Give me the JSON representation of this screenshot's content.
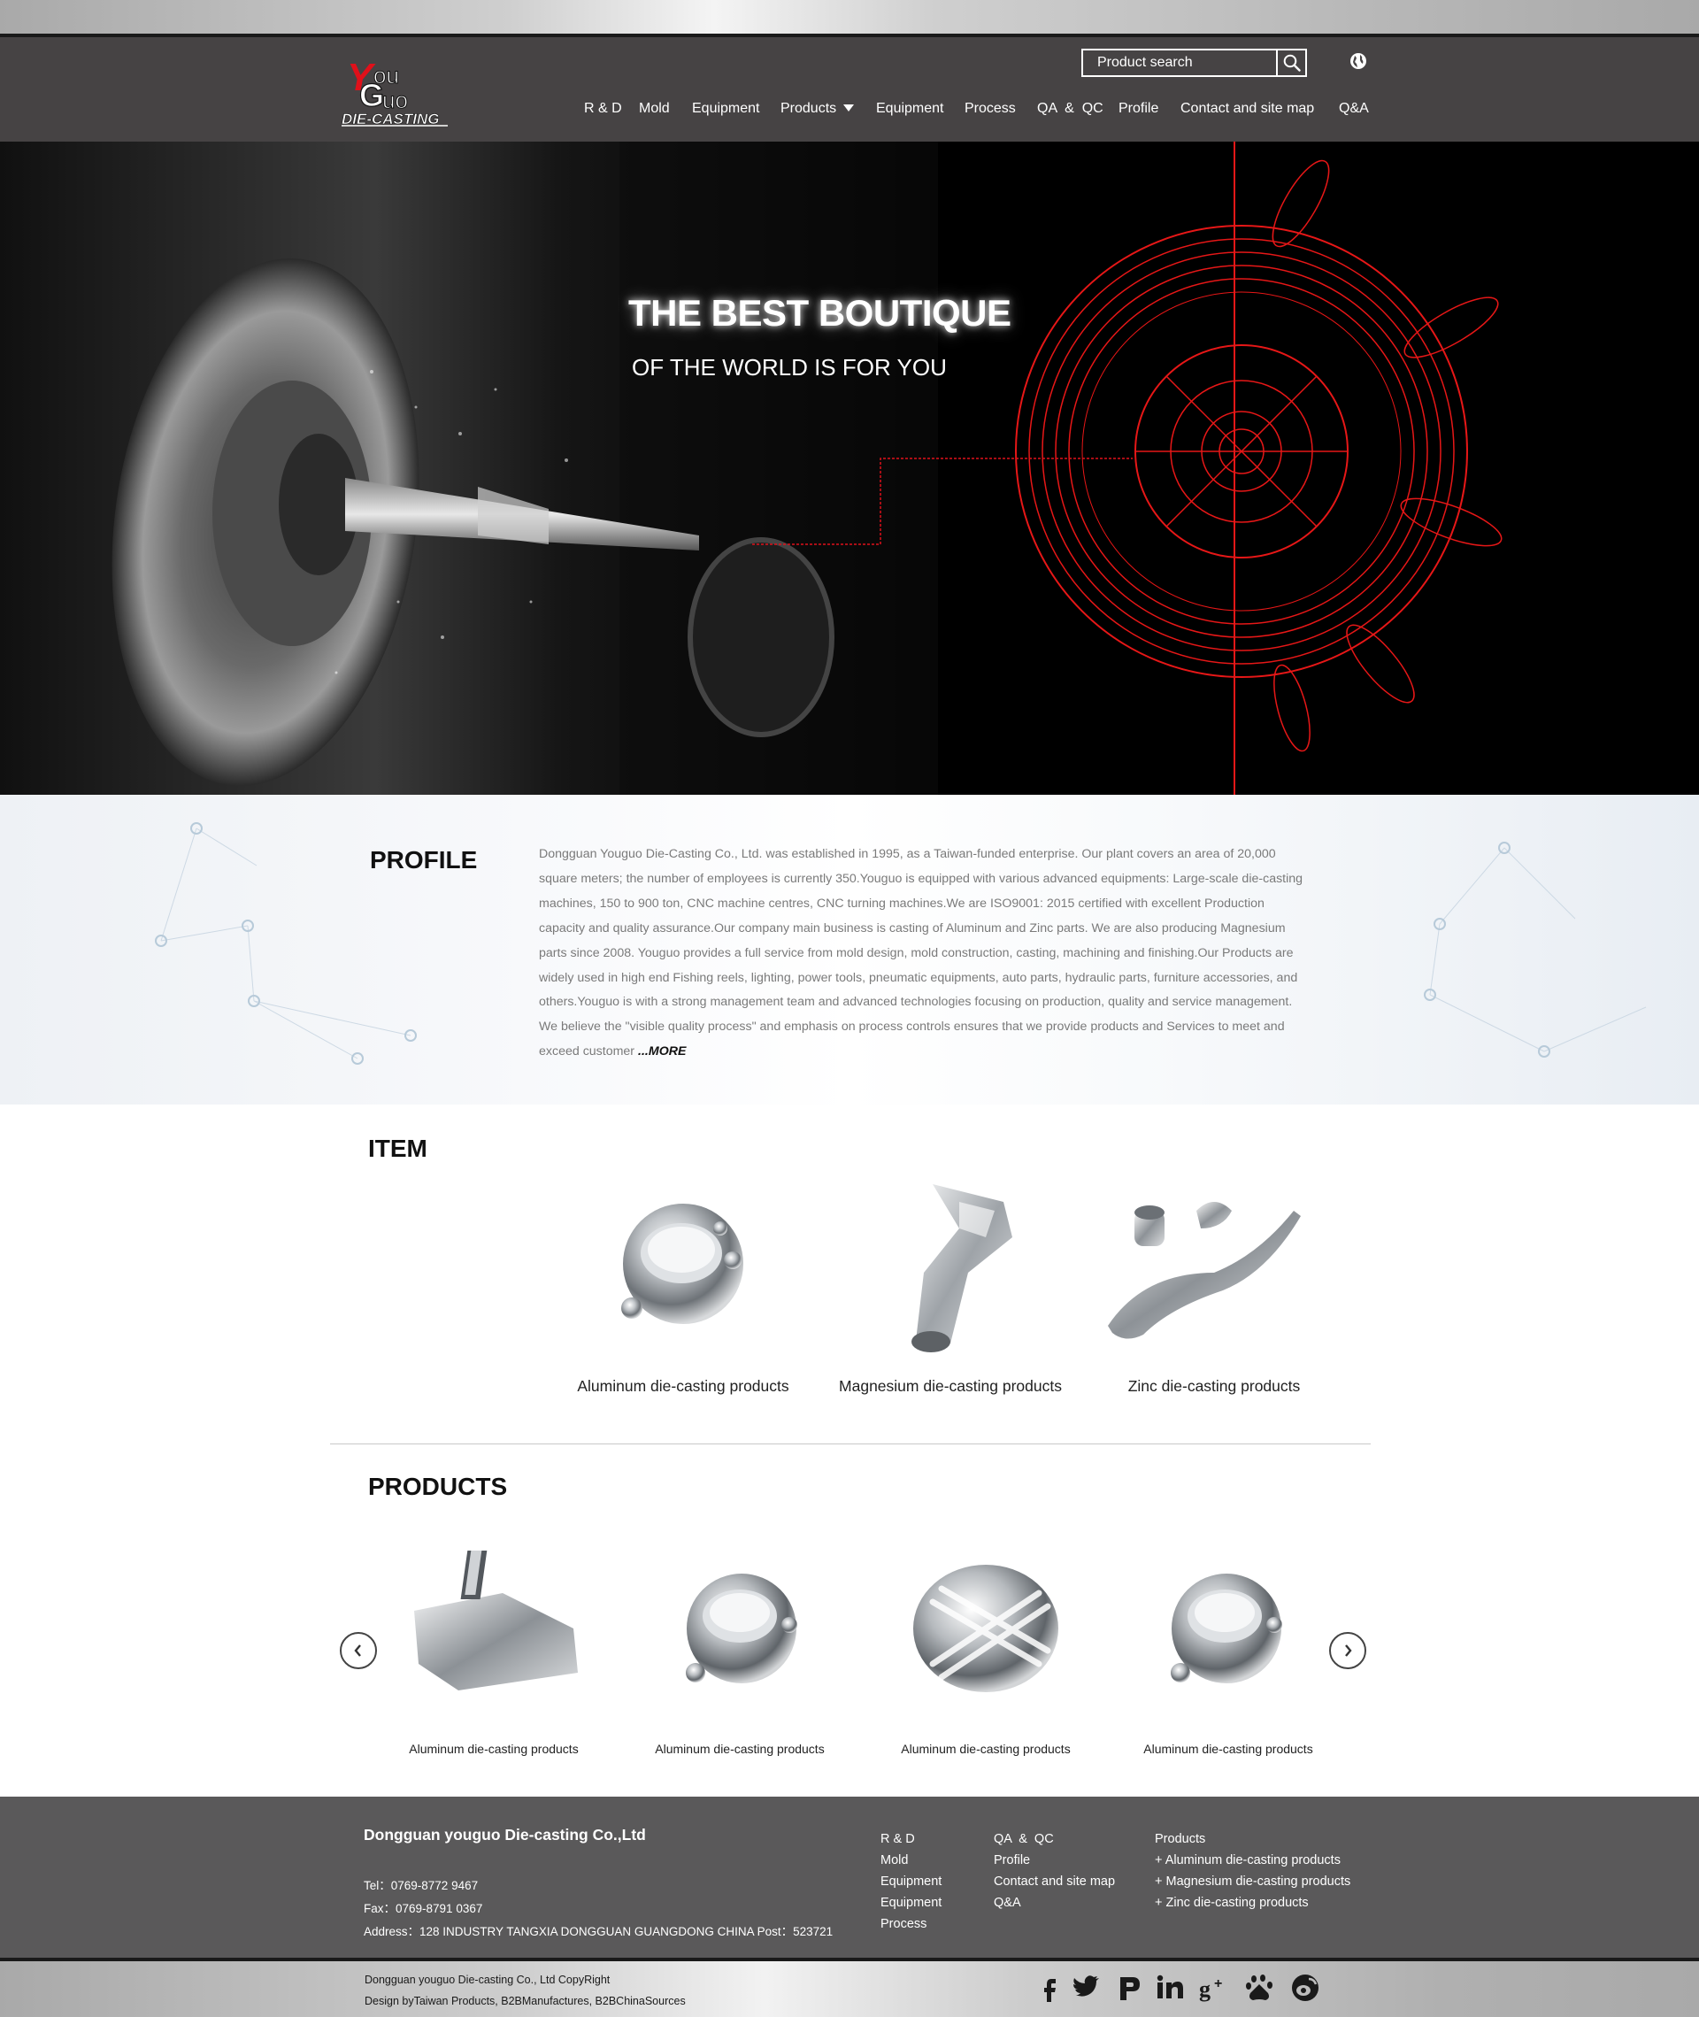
{
  "header": {
    "logo_alt": "Youguo Die-Casting",
    "search_placeholder": "Product search",
    "nav": [
      {
        "label": "R & D"
      },
      {
        "label": "Mold"
      },
      {
        "label": "Equipment"
      },
      {
        "label": "Products"
      },
      {
        "label": "Equipment"
      },
      {
        "label": "Process"
      },
      {
        "label": "QA  &  QC"
      },
      {
        "label": "Profile"
      },
      {
        "label": "Contact and site map"
      },
      {
        "label": "Q&A"
      }
    ]
  },
  "hero": {
    "title": "THE BEST BOUTIQUE",
    "subtitle": "OF THE WORLD IS FOR YOU"
  },
  "profile": {
    "title": "PROFILE",
    "text": "Dongguan Youguo Die-Casting Co., Ltd. was established in 1995, as a Taiwan-funded enterprise. Our plant covers an area of 20,000 square meters; the number of employees is currently 350.Youguo is equipped with various advanced equipments: Large-scale die-casting machines, 150 to 900 ton, CNC machine centres, CNC turning machines.We are ISO9001: 2015 certified with excellent Production capacity and quality assurance.Our company main business is casting of Aluminum and Zinc parts. We are also producing Magnesium parts since 2008. Youguo provides a full service from mold design, mold construction, casting, machining and finishing.Our Products are widely used in high end Fishing reels, lighting, power tools, pneumatic equipments, auto parts, hydraulic parts, furniture accessories, and others.Youguo is with a strong management team and advanced technologies focusing on production, quality and service management. We believe the \"visible quality process\" and emphasis on process controls ensures that we provide products and Services to meet and exceed customer",
    "more": "...MORE"
  },
  "items": {
    "title": "ITEM",
    "list": [
      {
        "label": "Aluminum die-casting products"
      },
      {
        "label": "Magnesium die-casting products"
      },
      {
        "label": "Zinc die-casting products"
      }
    ]
  },
  "products": {
    "title": "PRODUCTS",
    "list": [
      {
        "label": "Aluminum die-casting products"
      },
      {
        "label": "Aluminum die-casting products"
      },
      {
        "label": "Aluminum die-casting products"
      },
      {
        "label": "Aluminum die-casting products"
      }
    ]
  },
  "footer": {
    "company": "Dongguan youguo Die-casting Co.,Ltd",
    "tel": "Tel：0769-8772 9467",
    "fax": "Fax：0769-8791 0367",
    "address": "Address：128 INDUSTRY TANGXIA DONGGUAN GUANGDONG CHINA Post：523721",
    "col1": [
      "R & D",
      "Mold",
      "Equipment",
      "Equipment",
      "Process"
    ],
    "col2": [
      "QA  &  QC",
      "Profile",
      "Contact and site map",
      "Q&A"
    ],
    "col3": [
      "Products",
      "+ Aluminum die-casting products",
      "+ Magnesium die-casting products",
      "+ Zinc die-casting products"
    ],
    "copyright": "Dongguan youguo Die-casting Co., Ltd CopyRight",
    "design": "Design byTaiwan Products, B2BManufactures, B2BChinaSources",
    "social_icons": [
      "facebook-icon",
      "twitter-icon",
      "pinterest-icon",
      "linkedin-icon",
      "google-plus-icon",
      "baidu-icon",
      "weibo-icon"
    ]
  },
  "colors": {
    "header_bg": "#464344",
    "footer_bg": "#5a595a",
    "accent_red": "#e0101a"
  }
}
